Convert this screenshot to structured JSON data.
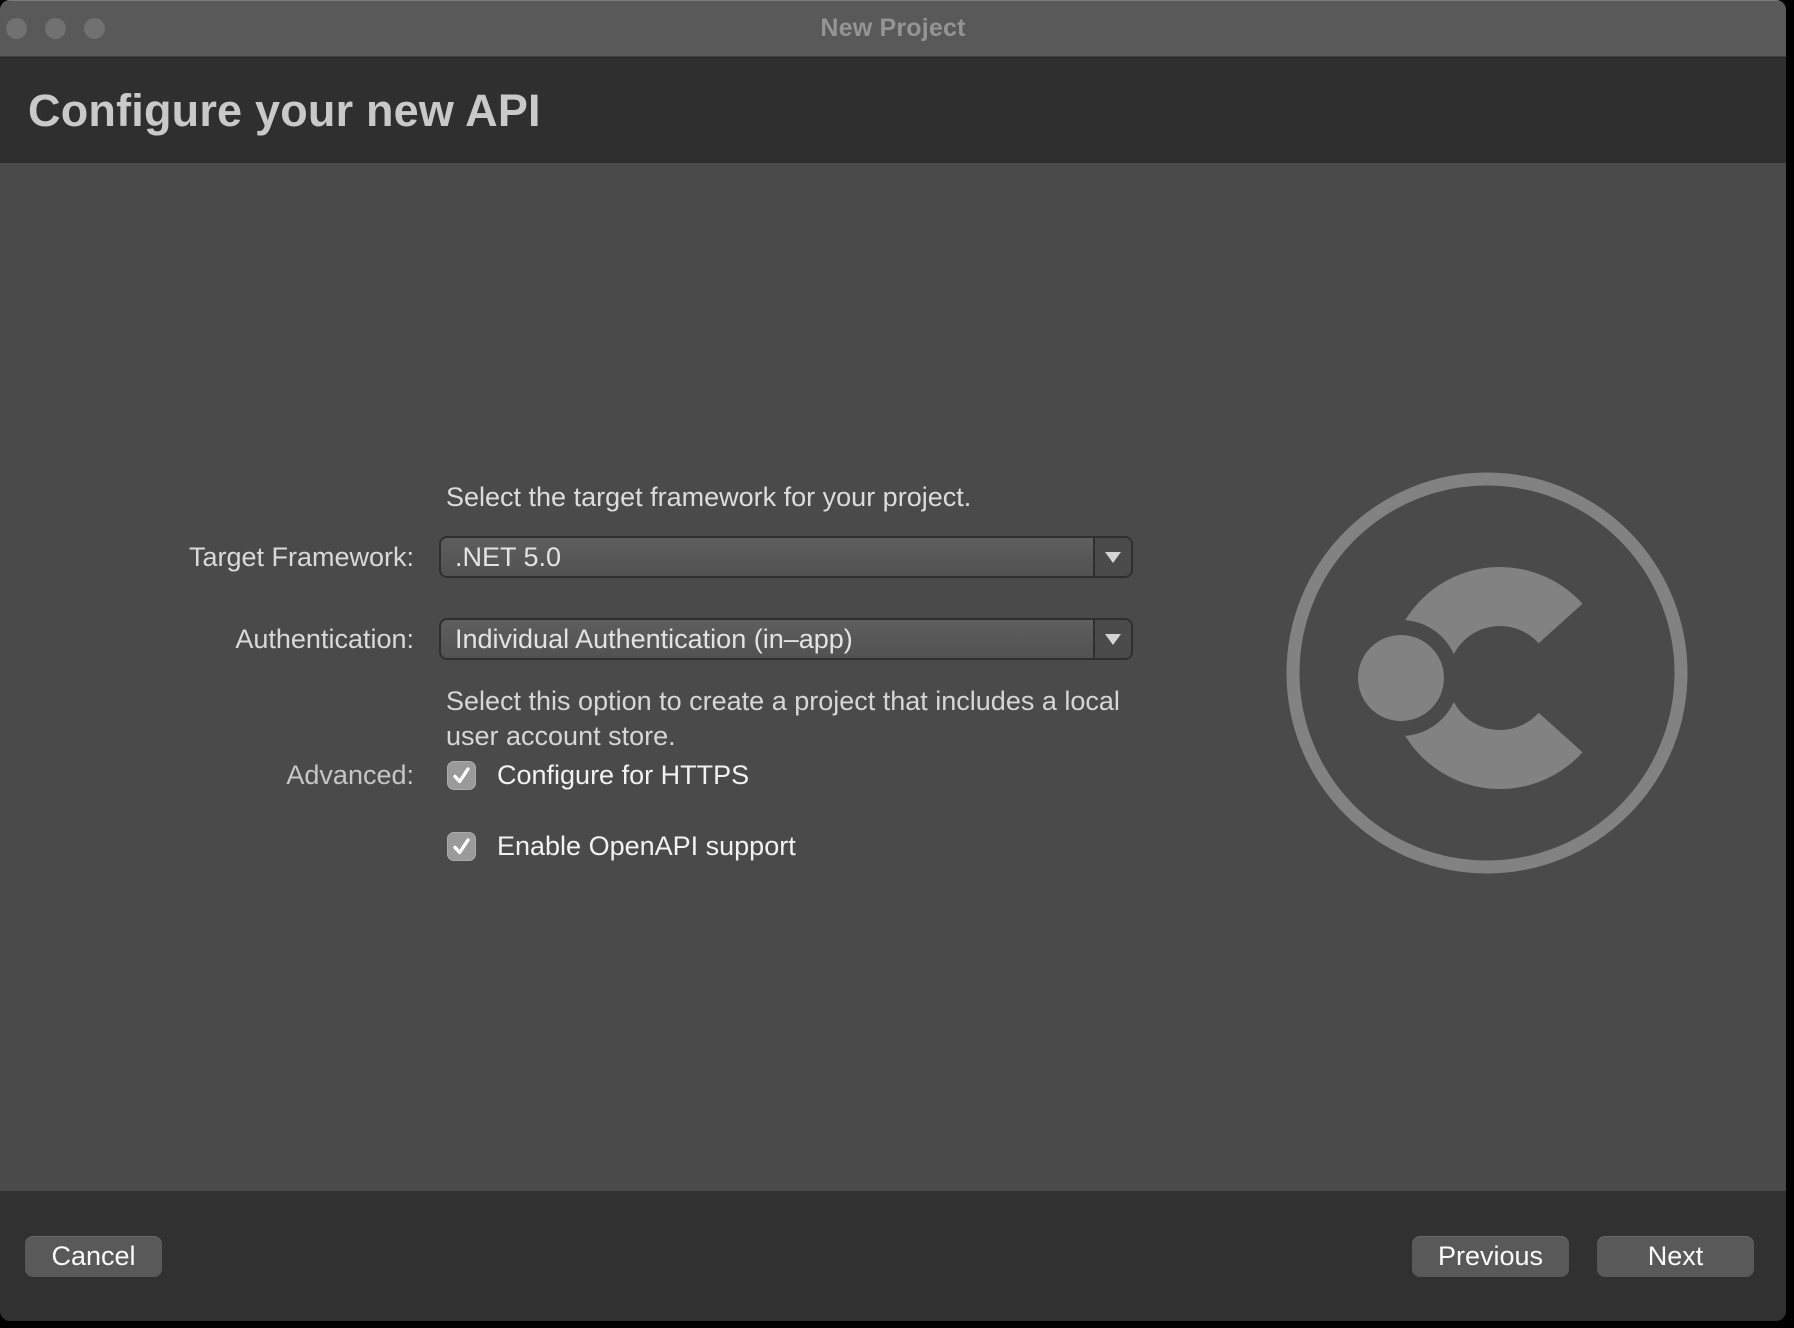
{
  "window": {
    "title": "New Project",
    "controls": [
      "close",
      "minimize",
      "zoom"
    ]
  },
  "header": {
    "title": "Configure your new API"
  },
  "form": {
    "intro": "Select the target framework for your project.",
    "target_framework": {
      "label": "Target Framework:",
      "value": ".NET 5.0"
    },
    "authentication": {
      "label": "Authentication:",
      "value": "Individual Authentication (in–app)"
    },
    "auth_description_lines": [
      "Select this option to create a project that includes a local",
      "user account store."
    ],
    "advanced": {
      "label": "Advanced:",
      "options": [
        {
          "label": "Configure for HTTPS",
          "checked": true
        },
        {
          "label": "Enable OpenAPI support",
          "checked": true
        }
      ]
    }
  },
  "footer": {
    "cancel_label": "Cancel",
    "previous_label": "Previous",
    "next_label": "Next"
  },
  "icons": {
    "dropdown_arrow": "chevron-down",
    "logo": "dotnet-api-circle-logo",
    "checkmark": "check"
  },
  "colors": {
    "window_background": "#4a4a4a",
    "titlebar_background": "#595959",
    "header_background": "#2f2f2f",
    "footer_background": "#313131",
    "control_fill": "#565656",
    "control_border": "#2f2f2f",
    "button_fill": "#595959",
    "checkbox_fill": "#9a9a9a",
    "logo_gray": "#828282",
    "text_primary": "#f2f2f2",
    "text_secondary": "#d9d9d9",
    "title_text": "#949494",
    "header_text": "#c9c9c9"
  }
}
